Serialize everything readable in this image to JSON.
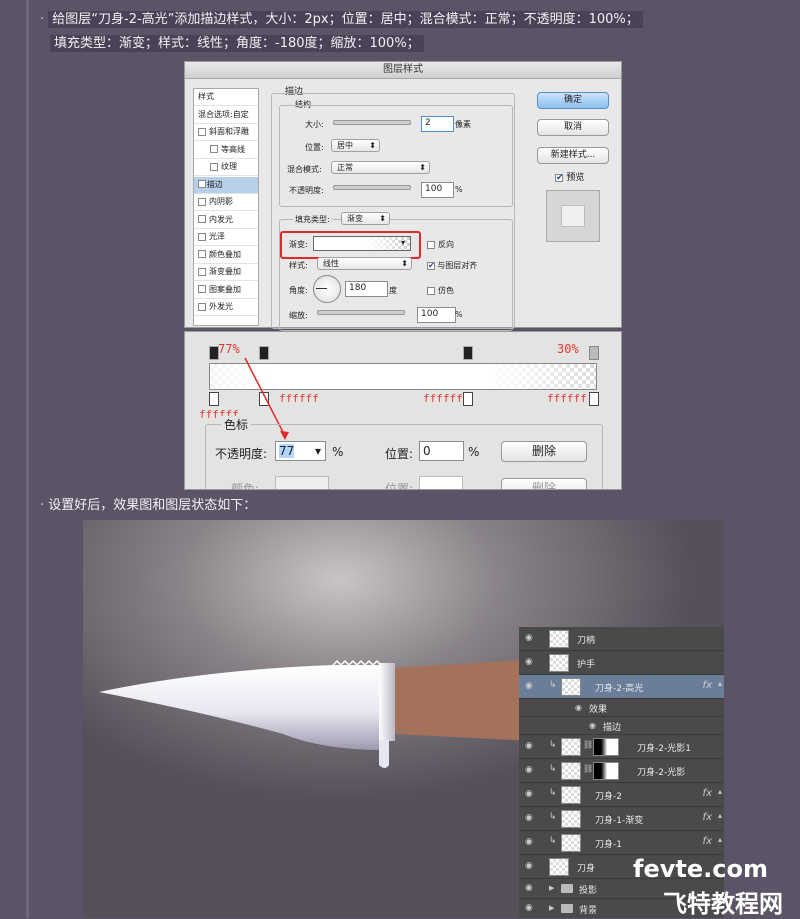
{
  "instructions": {
    "line1": "给图层“刀身-2-高光”添加描边样式，大小：2px；位置：居中；混合模式：正常；不透明度：100%；",
    "line2": "填充类型：渐变；样式：线性；角度：-180度；缩放：100%；",
    "line3": "设置好后，效果图和图层状态如下："
  },
  "dialog": {
    "title": "图层样式",
    "left_items": [
      {
        "label": "样式"
      },
      {
        "label": "混合选项:自定"
      },
      {
        "label": "斜面和浮雕"
      },
      {
        "label": "等高线"
      },
      {
        "label": "纹理"
      },
      {
        "label": "描边"
      },
      {
        "label": "内阴影"
      },
      {
        "label": "内发光"
      },
      {
        "label": "光泽"
      },
      {
        "label": "颜色叠加"
      },
      {
        "label": "渐变叠加"
      },
      {
        "label": "图案叠加"
      },
      {
        "label": "外发光"
      }
    ],
    "stroke_title": "描边",
    "structure_title": "结构",
    "size_label": "大小:",
    "size_value": "2",
    "size_unit": "像素",
    "position_label": "位置:",
    "position_value": "居中",
    "blend_label": "混合模式:",
    "blend_value": "正常",
    "opacity_label": "不透明度:",
    "opacity_value": "100",
    "percent": "%",
    "fill_type_label": "填充类型:",
    "fill_type_value": "渐变",
    "gradient_label": "渐变:",
    "reverse_label": "反向",
    "style_label": "样式:",
    "style_value": "线性",
    "align_label": "与图层对齐",
    "angle_label": "角度:",
    "angle_value": "180",
    "angle_unit": "度",
    "dither_label": "仿色",
    "scale_label": "缩放:",
    "scale_value": "100",
    "ok": "确定",
    "cancel": "取消",
    "new_style": "新建样式...",
    "preview": "预览"
  },
  "gradient_editor": {
    "stop_left_opacity": "77%",
    "stop_right_opacity": "30%",
    "color_stops": [
      "ffffff",
      "ffffff",
      "ffffff",
      "ffffff"
    ],
    "section_title": "色标",
    "opacity_label": "不透明度:",
    "opacity_value": "77",
    "percent": "%",
    "location_label": "位置:",
    "location_value": "0",
    "delete": "删除",
    "color_label": "颜色:",
    "location_label2": "位置:",
    "delete2": "删除"
  },
  "layers": [
    {
      "name": "刀柄",
      "fx": false,
      "clip": false
    },
    {
      "name": "护手",
      "fx": false,
      "clip": false
    },
    {
      "name": "刀身-2-高光",
      "fx": true,
      "clip": true,
      "selected": true
    },
    {
      "name": "效果",
      "sub": true
    },
    {
      "name": "描边",
      "sub2": true
    },
    {
      "name": "刀身-2-光影1",
      "fx": false,
      "clip": true,
      "mask": true
    },
    {
      "name": "刀身-2-光影",
      "fx": false,
      "clip": true,
      "mask": true
    },
    {
      "name": "刀身-2",
      "fx": true,
      "clip": true
    },
    {
      "name": "刀身-1-渐变",
      "fx": true,
      "clip": true
    },
    {
      "name": "刀身-1",
      "fx": true,
      "clip": true
    },
    {
      "name": "刀身",
      "fx": false,
      "clip": false
    },
    {
      "name": "投影",
      "folder": true
    },
    {
      "name": "背景",
      "folder": true
    }
  ],
  "fx_glyph": "fx",
  "watermark": {
    "line1": "fevte.com",
    "line2": "飞特教程网"
  },
  "colors": {
    "accent_red": "#e8372f",
    "selected_layer": "#6b7e99",
    "panel": "#4a4a4a",
    "handle": "#a4725a"
  }
}
